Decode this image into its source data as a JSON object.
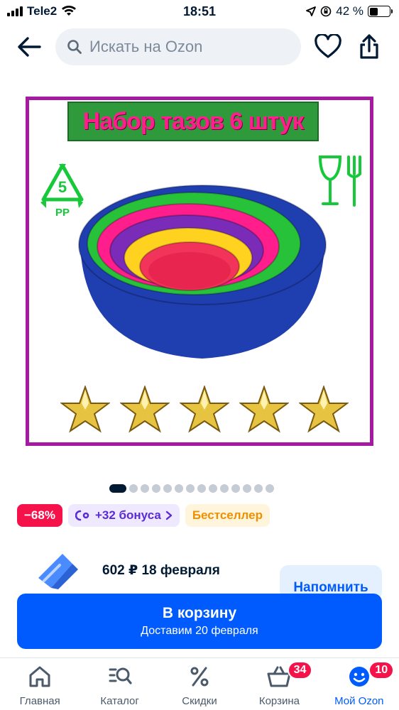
{
  "status_bar": {
    "carrier": "Tele2",
    "time": "18:51",
    "battery": "42 %",
    "battery_level": 0.42
  },
  "header": {
    "search_placeholder": "Искать на Ozon",
    "icons": {
      "back": "arrow-left-icon",
      "search": "search-icon",
      "favorite": "heart-icon",
      "share": "share-icon"
    }
  },
  "product_image": {
    "banner_text": "Набор тазов 6 штук",
    "recycle_code": "5",
    "recycle_label": "PP",
    "star_count": 5,
    "bowl_colors": [
      "#1f3fb0",
      "#28c23a",
      "#ff1e8c",
      "#7a2bb8",
      "#ffd21f",
      "#f2335a"
    ],
    "border_color": "#a51aa0"
  },
  "gallery": {
    "total": 14,
    "current": 1
  },
  "badges": {
    "discount": "−68%",
    "bonus": "+32 бонуса",
    "bestseller": "Бестселлер"
  },
  "delivery_option": {
    "price_date": "602 ₽ 18 февраля",
    "remind_label": "Напомнить"
  },
  "cart_button": {
    "label": "В корзину",
    "sublabel": "Доставим 20 февраля"
  },
  "tabbar": {
    "tabs": [
      {
        "label": "Главная",
        "icon": "home-icon"
      },
      {
        "label": "Каталог",
        "icon": "catalog-search-icon"
      },
      {
        "label": "Скидки",
        "icon": "percent-icon"
      },
      {
        "label": "Корзина",
        "icon": "basket-icon",
        "badge": "34"
      },
      {
        "label": "Мой Ozon",
        "icon": "profile-smile-icon",
        "badge": "10"
      }
    ]
  },
  "colors": {
    "brand_blue": "#005bff",
    "discount_red": "#f5124b",
    "bonus_purple": "#5b2bd6",
    "bestseller_orange": "#f09000"
  }
}
